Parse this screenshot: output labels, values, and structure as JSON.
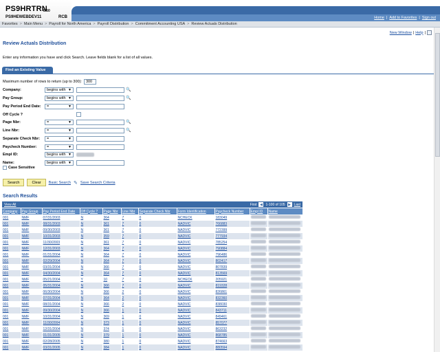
{
  "header": {
    "logo_main": "PS9HRTRN",
    "logo_version": "8.50",
    "logo_sub": "PS9HEWEBDEV11",
    "logo_sub2": "RCB",
    "links": [
      "Home",
      "Add to Favorites",
      "Sign out"
    ]
  },
  "nav": {
    "crumbs": [
      "Favorites",
      "Main Menu",
      "Payroll for North America",
      "Payroll Distribution",
      "Commitment Accounting USA",
      "Review Actuals Distribution"
    ]
  },
  "util": {
    "new_window": "New Window",
    "help": "Help"
  },
  "page": {
    "title": "Review Actuals Distribution",
    "instructions": "Enter any information you have and click Search. Leave fields blank for a list of all values.",
    "tab": "Find an Existing Value",
    "max_rows_label": "Maximum number of rows to return (up to 300):",
    "max_rows_value": "300"
  },
  "fields": [
    {
      "label": "Company:",
      "op": "begins with",
      "lens": true
    },
    {
      "label": "Pay Group:",
      "op": "begins with",
      "lens": true
    },
    {
      "label": "Pay Period End Date:",
      "op": "=",
      "lens": false
    },
    {
      "label": "Off Cycle ?",
      "op": "",
      "checkbox": true
    },
    {
      "label": "Page Nbr:",
      "op": "=",
      "lens": true
    },
    {
      "label": "Line Nbr:",
      "op": "=",
      "lens": true
    },
    {
      "label": "Separate Check Nbr:",
      "op": "=",
      "lens": false
    },
    {
      "label": "Paycheck Number:",
      "op": "=",
      "lens": false
    },
    {
      "label": "Empl ID:",
      "op": "begins with",
      "blurred": true
    },
    {
      "label": "Name:",
      "op": "begins with",
      "lens": false
    }
  ],
  "case_sensitive_label": "Case Sensitive",
  "buttons": {
    "search": "Search",
    "clear": "Clear",
    "basic_search": "Basic Search",
    "save_criteria": "Save Search Criteria"
  },
  "results": {
    "title": "Search Results",
    "view_all": "View All",
    "first": "First",
    "range": "1-100 of 105",
    "last": "Last",
    "columns": [
      "Company",
      "Pay Group",
      "Pay Period End Date",
      "Off Cycle ?",
      "Page Nbr",
      "Line Nbr",
      "Separate Check Nbr",
      "Form Identification",
      "Paycheck Number",
      "Empl ID",
      "Name"
    ],
    "rows": [
      [
        "001",
        "NMF",
        "07/31/2003",
        "N",
        "364",
        "7",
        "0",
        "NCHECK",
        "183049"
      ],
      [
        "001",
        "NMF",
        "08/31/2003",
        "N",
        "361",
        "7",
        "0",
        "NADVIC",
        "766883"
      ],
      [
        "001",
        "NMF",
        "09/30/2003",
        "N",
        "361",
        "7",
        "0",
        "NADVIC",
        "772399"
      ],
      [
        "001",
        "NMF",
        "10/31/2003",
        "N",
        "359",
        "7",
        "0",
        "NADVIC",
        "777934"
      ],
      [
        "001",
        "NMF",
        "11/30/2003",
        "N",
        "361",
        "7",
        "0",
        "NADVIC",
        "785254"
      ],
      [
        "001",
        "NMF",
        "12/31/2003",
        "N",
        "364",
        "7",
        "0",
        "NADVIC",
        "790884"
      ],
      [
        "001",
        "NMF",
        "01/31/2004",
        "N",
        "364",
        "7",
        "0",
        "NADVIC",
        "796486"
      ],
      [
        "001",
        "NMF",
        "02/29/2004",
        "N",
        "364",
        "7",
        "0",
        "NADVIC",
        "802417"
      ],
      [
        "001",
        "NMF",
        "03/31/2004",
        "N",
        "366",
        "7",
        "0",
        "NADVIC",
        "807839"
      ],
      [
        "001",
        "NMF",
        "04/30/2004",
        "N",
        "364",
        "7",
        "0",
        "NADVIC",
        "813569"
      ],
      [
        "001",
        "NMF",
        "05/21/2004",
        "Y",
        "10",
        "7",
        "0",
        "NCHECK",
        "205921"
      ],
      [
        "001",
        "NMF",
        "05/31/2004",
        "N",
        "366",
        "7",
        "0",
        "NADVIC",
        "819328"
      ],
      [
        "001",
        "NMF",
        "06/30/2004",
        "N",
        "366",
        "2",
        "0",
        "NADVIC",
        "826861"
      ],
      [
        "001",
        "NMF",
        "07/31/2004",
        "N",
        "364",
        "2",
        "0",
        "NADVIC",
        "832360"
      ],
      [
        "001",
        "NMF",
        "08/31/2004",
        "N",
        "366",
        "2",
        "0",
        "NADVIC",
        "838030"
      ],
      [
        "001",
        "NMF",
        "09/30/2004",
        "N",
        "366",
        "1",
        "0",
        "NADVIC",
        "843711"
      ],
      [
        "001",
        "NMF",
        "10/31/2004",
        "N",
        "369",
        "1",
        "0",
        "NADVIC",
        "849461"
      ],
      [
        "001",
        "NMF",
        "11/30/2004",
        "N",
        "373",
        "1",
        "0",
        "NADVIC",
        "857077"
      ],
      [
        "001",
        "NMF",
        "12/31/2004",
        "N",
        "374",
        "1",
        "0",
        "NADVIC",
        "863232"
      ],
      [
        "001",
        "NMF",
        "01/31/2005",
        "N",
        "379",
        "1",
        "0",
        "NADVIC",
        "868785"
      ],
      [
        "001",
        "NMF",
        "02/28/2005",
        "N",
        "380",
        "1",
        "0",
        "NADVIC",
        "874663"
      ],
      [
        "001",
        "NMF",
        "03/31/2005",
        "N",
        "384",
        "1",
        "0",
        "NADVIC",
        "880594"
      ]
    ]
  }
}
